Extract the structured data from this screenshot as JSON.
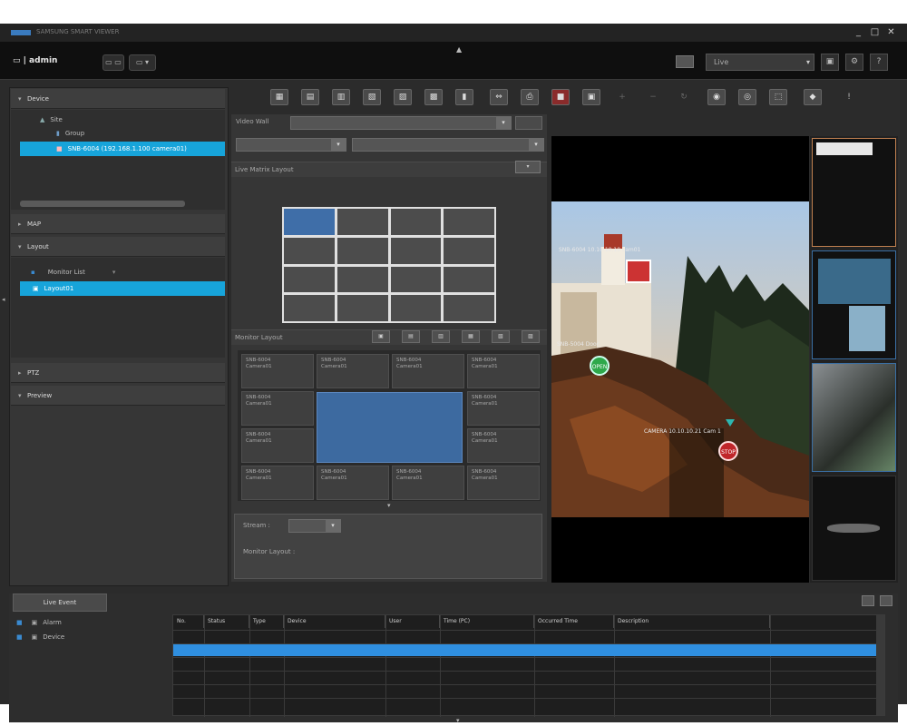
{
  "window": {
    "app_title": "SAMSUNG SMART VIEWER",
    "controls": [
      "_",
      "□",
      "✕"
    ]
  },
  "toolbar": {
    "user_label": "▭ | admin",
    "btn1": "▭ ▭",
    "btn2": "▭ ▾",
    "combo_value": "Live",
    "icons": [
      "▣",
      "⚙",
      "?"
    ]
  },
  "left": {
    "device_header": "Device",
    "tree": [
      {
        "label": "Site",
        "depth": 1
      },
      {
        "label": "Group",
        "depth": 2
      },
      {
        "label": "SNB-6004 (192.168.1.100 camera01)",
        "depth": 2,
        "selected": true
      }
    ],
    "mapview_header": "MAP",
    "layout_header": "Layout",
    "layout_items": [
      {
        "label": "Monitor List",
        "selected": false
      },
      {
        "label": "Layout01",
        "selected": true
      }
    ],
    "ptz_header": "PTZ",
    "preview_header": "Preview"
  },
  "mid": {
    "video_wall_label": "Video Wall",
    "grid_label": "Live Matrix Layout",
    "monitor_layout_label": "Monitor Layout",
    "monitor_cell_lines": [
      "SNB-6004",
      "Camera01"
    ],
    "monitor_cells": 14,
    "status_label": "Stream :",
    "monitor_layout_text": "Monitor Layout :",
    "layout_btns": [
      "▣",
      "▤",
      "▥",
      "▦",
      "▧",
      "▨"
    ]
  },
  "video": {
    "tags": [
      "SNB-6004 10.10.10.10 cam01",
      "SNB-5004 Door",
      "CAMERA 10.10.10.21 Cam 1"
    ],
    "markers": [
      "OPEN",
      "STOP"
    ]
  },
  "bottom": {
    "tab_label": "Live Event",
    "filters": [
      "Alarm",
      "Device"
    ],
    "columns": [
      "No.",
      "Status",
      "Type",
      "Device",
      "User",
      "Time (PC)",
      "Occurred Time",
      "Description"
    ]
  },
  "colors": {
    "accent": "#17a4da",
    "selection_blue": "#3f6ea8",
    "background": "#2b2b2b"
  }
}
